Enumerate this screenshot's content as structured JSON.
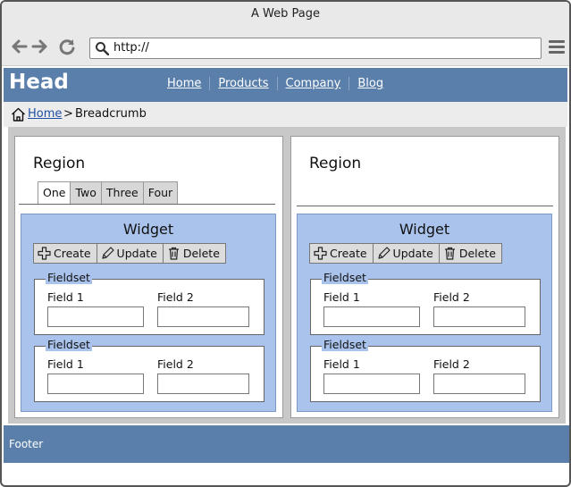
{
  "window": {
    "title": "A Web Page"
  },
  "browser": {
    "url": "http://"
  },
  "header": {
    "logo": "Head",
    "nav": [
      "Home",
      "Products",
      "Company",
      "Blog"
    ]
  },
  "breadcrumb": {
    "link": "Home",
    "separator": ">",
    "current": "Breadcrumb"
  },
  "regions": [
    {
      "title": "Region",
      "tabs": [
        "One",
        "Two",
        "Three",
        "Four"
      ],
      "widget": {
        "title": "Widget",
        "buttons": [
          "Create",
          "Update",
          "Delete"
        ],
        "fieldsets": [
          {
            "legend": "Fieldset",
            "field1": "Field 1",
            "field2": "Field 2"
          },
          {
            "legend": "Fieldset",
            "field1": "Field 1",
            "field2": "Field 2"
          }
        ]
      }
    },
    {
      "title": "Region",
      "widget": {
        "title": "Widget",
        "buttons": [
          "Create",
          "Update",
          "Delete"
        ],
        "fieldsets": [
          {
            "legend": "Fieldset",
            "field1": "Field 1",
            "field2": "Field 2"
          },
          {
            "legend": "Fieldset",
            "field1": "Field 1",
            "field2": "Field 2"
          }
        ]
      }
    }
  ],
  "footer": {
    "text": "Footer"
  },
  "colors": {
    "header_bg": "#5a7fab",
    "widget_bg": "#a9c3ec",
    "link": "#1f4fa5"
  }
}
